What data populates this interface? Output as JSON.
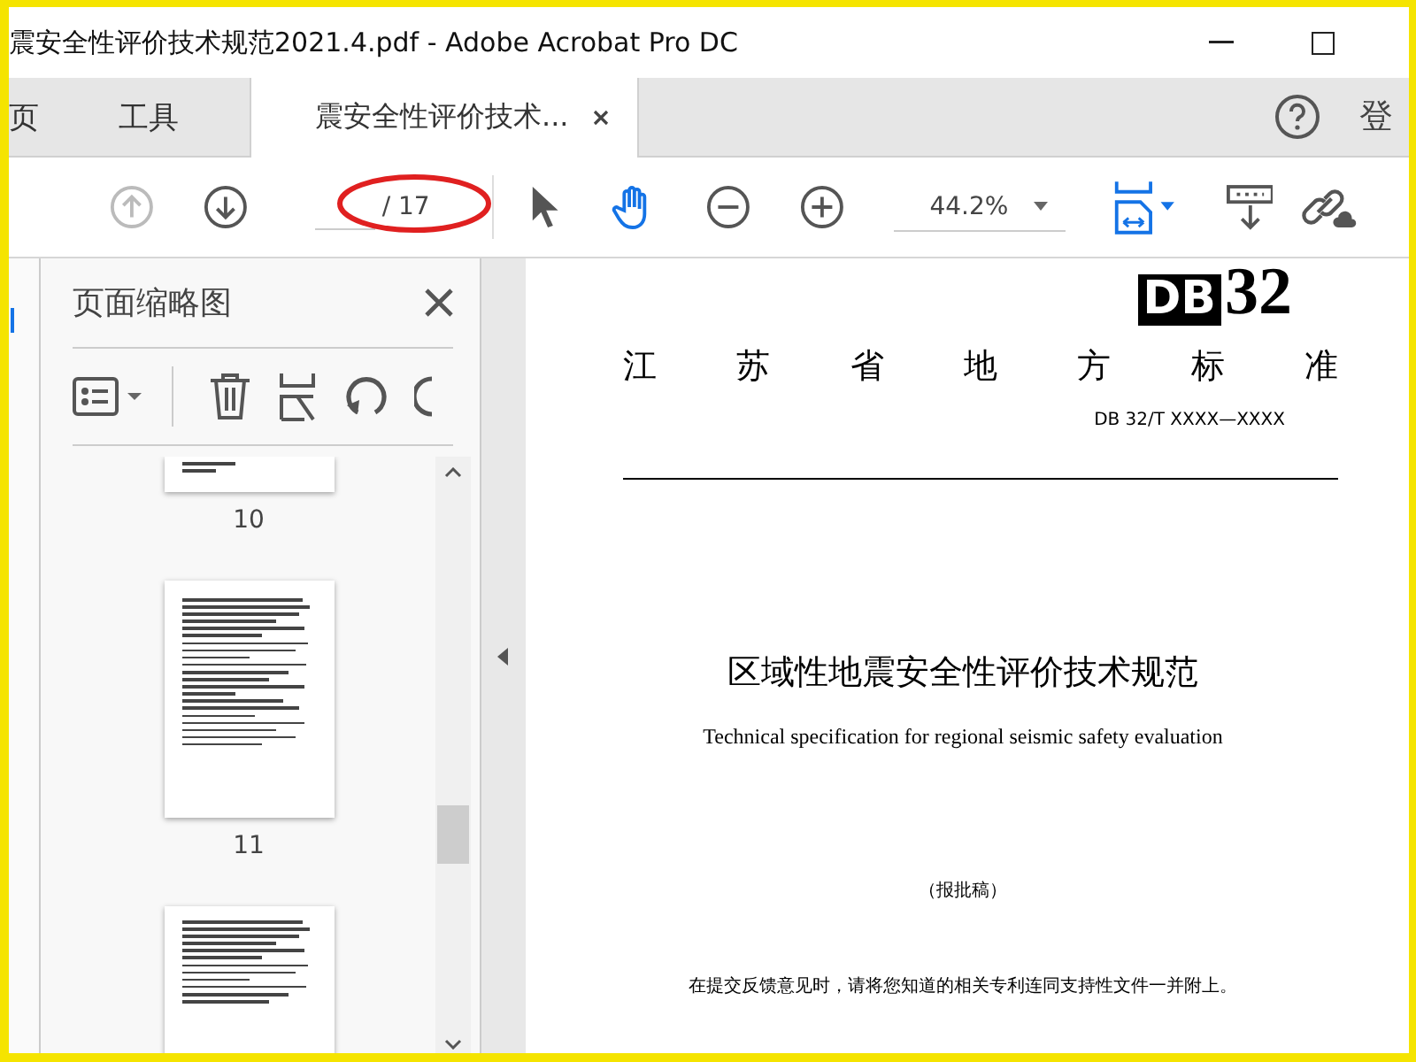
{
  "window": {
    "title": "震安全性评价技术规范2021.4.pdf - Adobe Acrobat Pro DC"
  },
  "nav_tabs": [
    {
      "label": "页",
      "selected": false
    },
    {
      "label": "工具",
      "selected": false
    },
    {
      "label": "震安全性评价技术...",
      "selected": true
    }
  ],
  "sign_in": "登",
  "toolbar": {
    "page_total": "/ 17",
    "zoom": "44.2%",
    "hand_tool_selected": true
  },
  "sidebar": {
    "title": "页面缩略图",
    "thumbnails": [
      {
        "label": "10"
      },
      {
        "label": "11"
      }
    ]
  },
  "document": {
    "code_letters": "DB",
    "code_number": "32",
    "region": "江苏省地方标准",
    "standard_no": "DB 32/T XXXX—XXXX",
    "title_cn": "区域性地震安全性评价技术规范",
    "title_en": "Technical specification for regional seismic safety evaluation",
    "status": "（报批稿）",
    "notice": "在提交反馈意见时，请将您知道的相关专利连同支持性文件一并附上。"
  }
}
